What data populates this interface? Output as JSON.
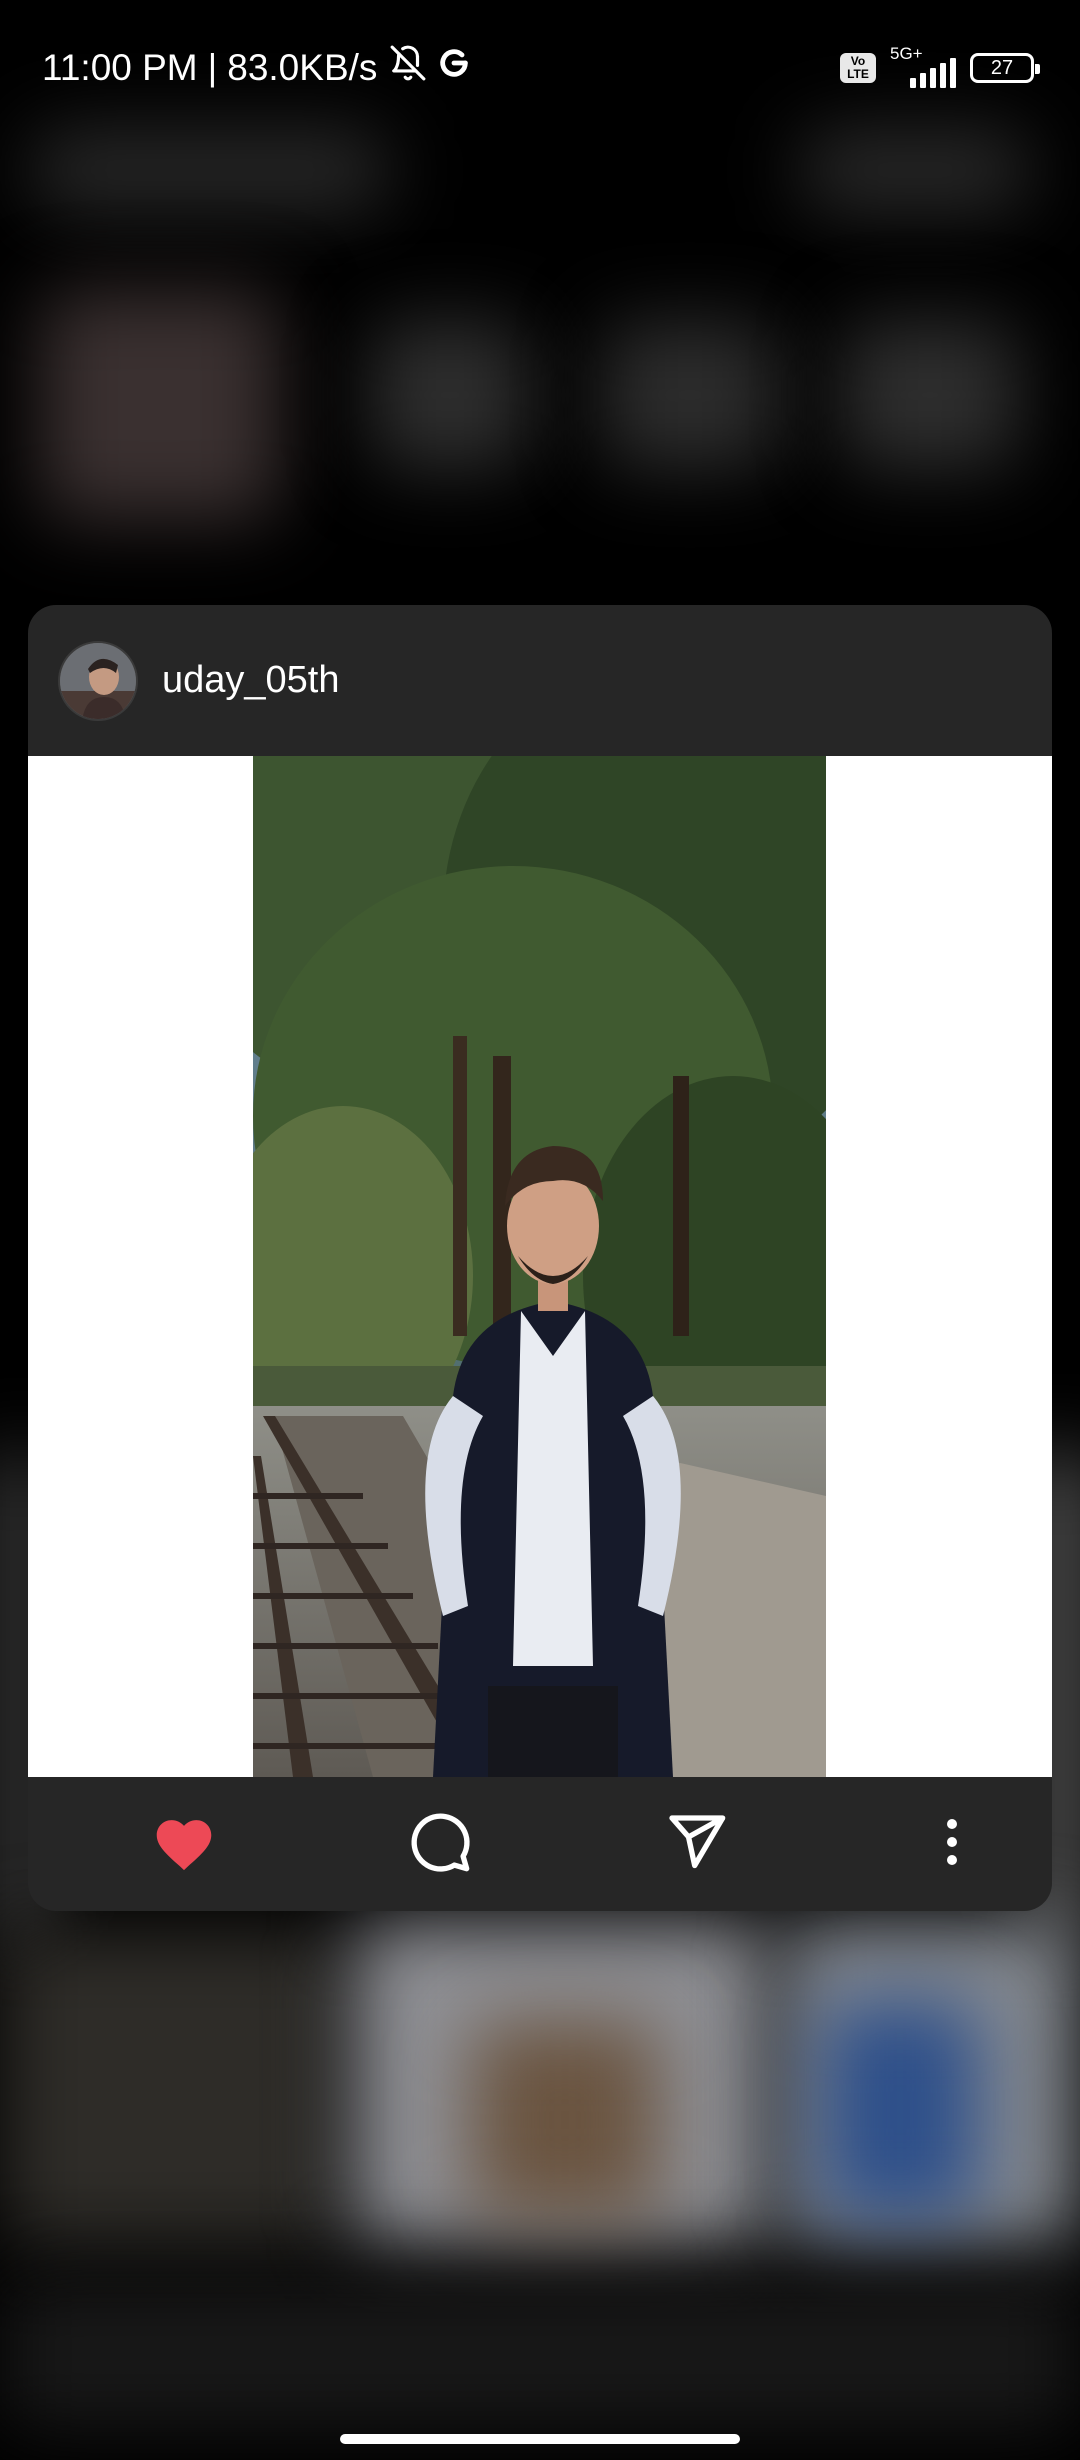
{
  "status_bar": {
    "time": "11:00 PM",
    "separator": "|",
    "network_speed": "83.0KB/s",
    "icons": [
      "bell-off-icon",
      "google-icon"
    ],
    "volte_label": "Vo LTE",
    "network_type": "5G+",
    "battery_level": "27"
  },
  "post": {
    "username": "uday_05th",
    "liked": true,
    "like_color": "#ed4956",
    "actions": [
      "heart-icon",
      "comment-icon",
      "share-icon",
      "more-options-icon"
    ]
  }
}
